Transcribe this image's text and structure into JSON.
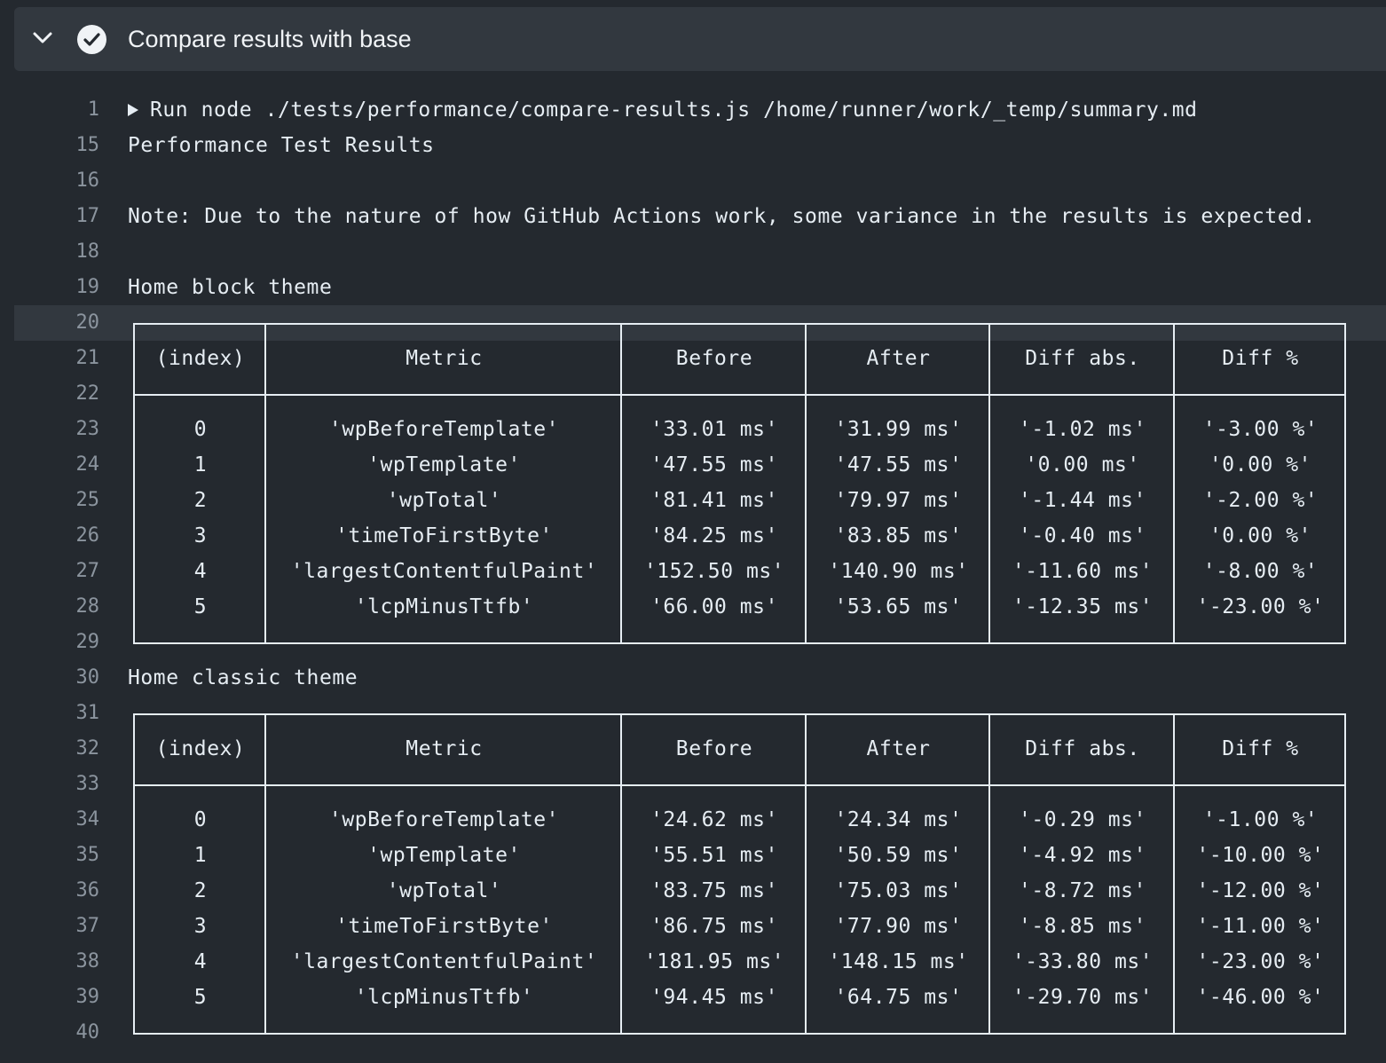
{
  "step": {
    "title": "Compare results with base",
    "status_icon": "check-circle-icon",
    "toggle_icon": "chevron-down-icon"
  },
  "log": {
    "run_command": "Run node ./tests/performance/compare-results.js /home/runner/work/_temp/summary.md",
    "lines": [
      {
        "n": "1"
      },
      {
        "n": "15",
        "text": "Performance Test Results"
      },
      {
        "n": "16",
        "text": ""
      },
      {
        "n": "17",
        "text": "Note: Due to the nature of how GitHub Actions work, some variance in the results is expected."
      },
      {
        "n": "18",
        "text": ""
      },
      {
        "n": "19",
        "text": "Home block theme"
      },
      {
        "n": "20"
      },
      {
        "n": "21"
      },
      {
        "n": "22"
      },
      {
        "n": "23"
      },
      {
        "n": "24"
      },
      {
        "n": "25"
      },
      {
        "n": "26"
      },
      {
        "n": "27"
      },
      {
        "n": "28"
      },
      {
        "n": "29"
      },
      {
        "n": "30",
        "text": "Home classic theme"
      },
      {
        "n": "31"
      },
      {
        "n": "32"
      },
      {
        "n": "33"
      },
      {
        "n": "34"
      },
      {
        "n": "35"
      },
      {
        "n": "36"
      },
      {
        "n": "37"
      },
      {
        "n": "38"
      },
      {
        "n": "39"
      },
      {
        "n": "40"
      }
    ]
  },
  "tables": [
    {
      "headers": [
        "(index)",
        "Metric",
        "Before",
        "After",
        "Diff abs.",
        "Diff %"
      ],
      "rows": [
        [
          "0",
          "'wpBeforeTemplate'",
          "'33.01 ms'",
          "'31.99 ms'",
          "'-1.02 ms'",
          "'-3.00 %'"
        ],
        [
          "1",
          "'wpTemplate'",
          "'47.55 ms'",
          "'47.55 ms'",
          "'0.00 ms'",
          "'0.00 %'"
        ],
        [
          "2",
          "'wpTotal'",
          "'81.41 ms'",
          "'79.97 ms'",
          "'-1.44 ms'",
          "'-2.00 %'"
        ],
        [
          "3",
          "'timeToFirstByte'",
          "'84.25 ms'",
          "'83.85 ms'",
          "'-0.40 ms'",
          "'0.00 %'"
        ],
        [
          "4",
          "'largestContentfulPaint'",
          "'152.50 ms'",
          "'140.90 ms'",
          "'-11.60 ms'",
          "'-8.00 %'"
        ],
        [
          "5",
          "'lcpMinusTtfb'",
          "'66.00 ms'",
          "'53.65 ms'",
          "'-12.35 ms'",
          "'-23.00 %'"
        ]
      ]
    },
    {
      "headers": [
        "(index)",
        "Metric",
        "Before",
        "After",
        "Diff abs.",
        "Diff %"
      ],
      "rows": [
        [
          "0",
          "'wpBeforeTemplate'",
          "'24.62 ms'",
          "'24.34 ms'",
          "'-0.29 ms'",
          "'-1.00 %'"
        ],
        [
          "1",
          "'wpTemplate'",
          "'55.51 ms'",
          "'50.59 ms'",
          "'-4.92 ms'",
          "'-10.00 %'"
        ],
        [
          "2",
          "'wpTotal'",
          "'83.75 ms'",
          "'75.03 ms'",
          "'-8.72 ms'",
          "'-12.00 %'"
        ],
        [
          "3",
          "'timeToFirstByte'",
          "'86.75 ms'",
          "'77.90 ms'",
          "'-8.85 ms'",
          "'-11.00 %'"
        ],
        [
          "4",
          "'largestContentfulPaint'",
          "'181.95 ms'",
          "'148.15 ms'",
          "'-33.80 ms'",
          "'-23.00 %'"
        ],
        [
          "5",
          "'lcpMinusTtfb'",
          "'94.45 ms'",
          "'64.75 ms'",
          "'-29.70 ms'",
          "'-46.00 %'"
        ]
      ]
    }
  ]
}
